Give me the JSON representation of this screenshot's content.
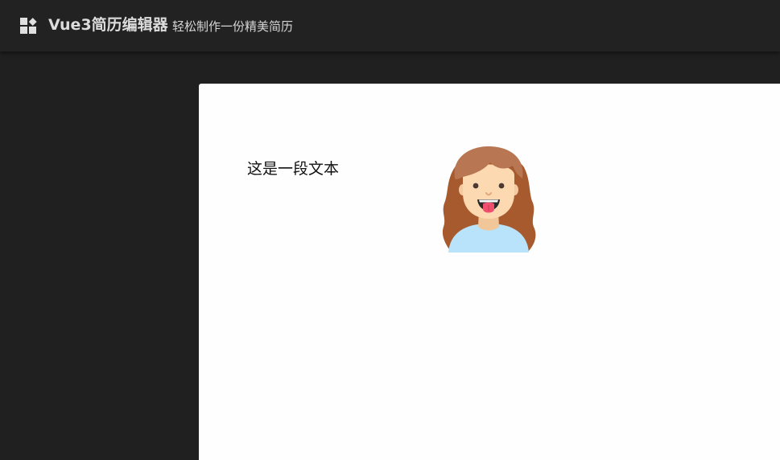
{
  "header": {
    "logo_icon": "blocks-logo-icon",
    "title": "Vue3简历编辑器",
    "subtitle": "轻松制作一份精美简历"
  },
  "canvas": {
    "text_block": "这是一段文本",
    "avatar_icon": "girl-avatar-icon"
  },
  "colors": {
    "header_bg": "#222222",
    "workspace_bg": "#202020",
    "canvas_bg": "#fefefe",
    "hair": "#a65a2e",
    "skin": "#fcd9b0",
    "shirt": "#b9e2fb",
    "tongue": "#f0506e"
  }
}
